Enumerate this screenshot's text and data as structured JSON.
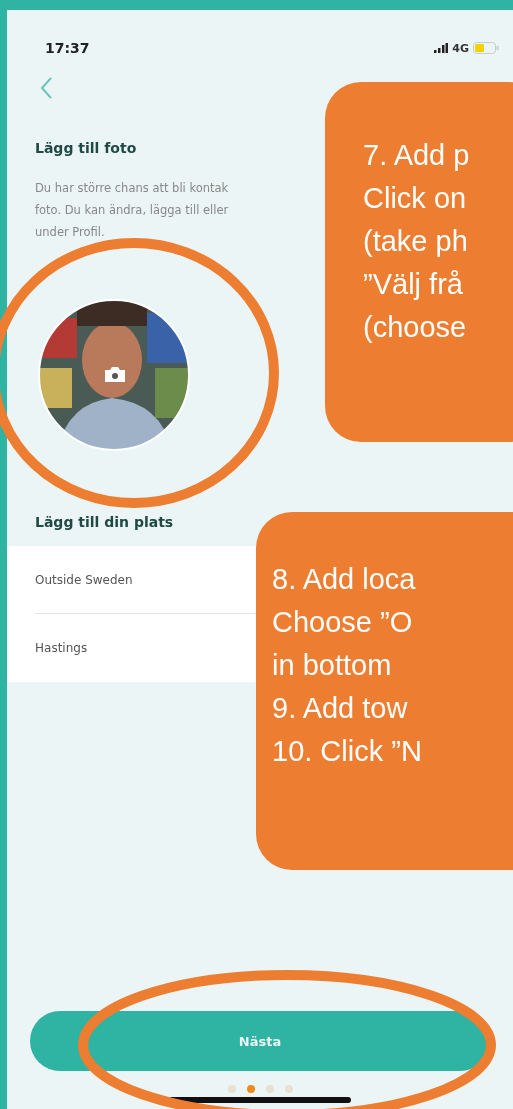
{
  "status_bar": {
    "time": "17:37",
    "network": "4G"
  },
  "photo_section": {
    "title": "Lägg till foto",
    "description_lines": [
      "Du har större chans att bli kontak",
      "foto. Du kan ändra, lägga till eller",
      "under Profil."
    ],
    "avatar": {
      "kind": "picture"
    }
  },
  "location_section": {
    "title": "Lägg till din plats",
    "rows": [
      {
        "value": "Outside Sweden"
      },
      {
        "value": "Hastings"
      }
    ]
  },
  "next_button": {
    "label": "Nästa"
  },
  "page_dots": [
    {
      "selected": false
    },
    {
      "selected": true
    },
    {
      "selected": false
    },
    {
      "selected": false
    }
  ],
  "callouts": [
    {
      "lines": [
        "7. Add p",
        "Click on",
        "(take ph",
        "”Välj frå",
        "(choose"
      ]
    },
    {
      "lines": [
        "8. Add loca",
        "Choose ”O",
        "in bottom",
        "9. Add tow",
        "10. Click ”N"
      ]
    }
  ]
}
